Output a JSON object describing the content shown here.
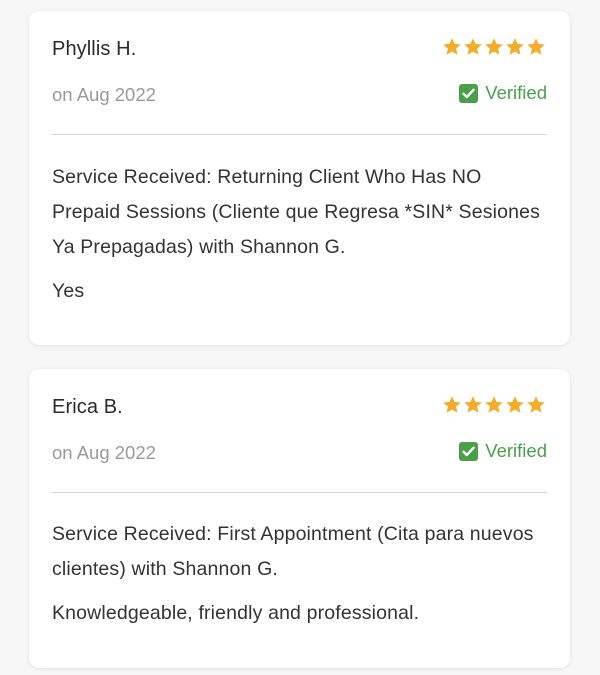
{
  "colors": {
    "star": "#f0ad2e",
    "verified": "#4aa04a",
    "text": "#333333",
    "muted": "#9a9a9a"
  },
  "reviews": [
    {
      "name": "Phyllis H.",
      "date": "on Aug 2022",
      "rating": 5,
      "verified_label": "Verified",
      "service": "Service Received: Returning Client Who Has NO Prepaid Sessions (Cliente que Regresa *SIN* Sesiones Ya Prepagadas) with Shannon G.",
      "text": "Yes"
    },
    {
      "name": "Erica B.",
      "date": "on Aug 2022",
      "rating": 5,
      "verified_label": "Verified",
      "service": "Service Received: First Appointment (Cita para nuevos clientes) with Shannon G.",
      "text": "Knowledgeable, friendly and professional."
    }
  ]
}
